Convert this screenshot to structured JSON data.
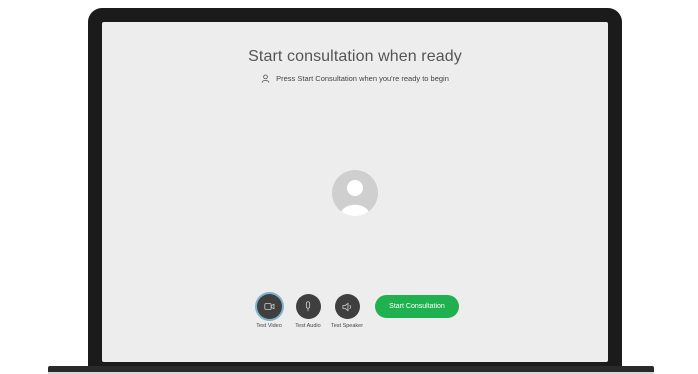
{
  "window": {
    "title": "Start consultation when ready",
    "subtitle": "Press Start Consultation when you're ready to begin"
  },
  "controls": [
    {
      "label": "Test Video",
      "icon": "video-camera-icon",
      "active": true
    },
    {
      "label": "Test Audio",
      "icon": "microphone-icon",
      "active": false
    },
    {
      "label": "Test Speaker",
      "icon": "speaker-icon",
      "active": false
    }
  ],
  "start_button": {
    "label": "Start Consultation"
  },
  "colors": {
    "accent_green": "#1fb150",
    "control_bg": "#3f3f3f",
    "screen_bg": "#ededed",
    "bezel": "#1b1b1b",
    "active_ring": "#7fb3c9"
  }
}
